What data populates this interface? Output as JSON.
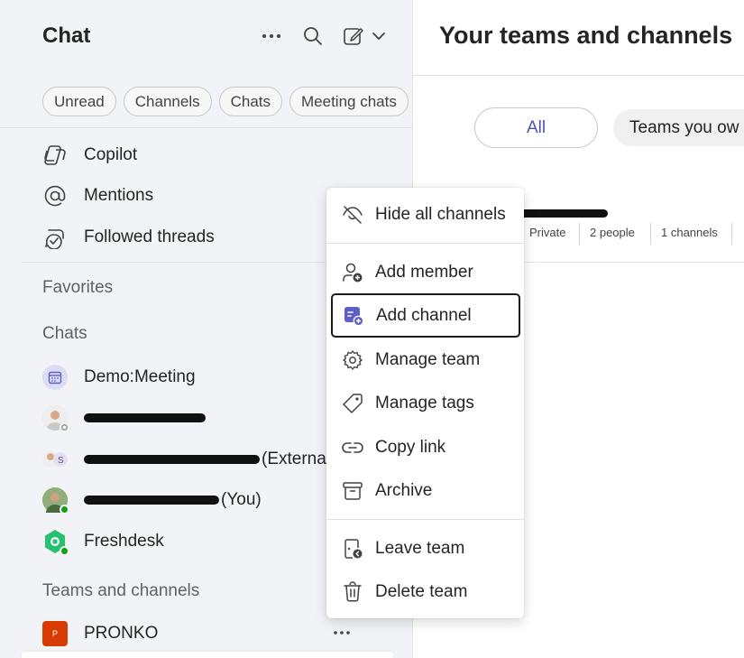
{
  "left": {
    "title": "Chat",
    "header_icons": [
      "more-icon",
      "search-icon",
      "compose-icon",
      "chevron-down-icon"
    ],
    "filters": [
      "Unread",
      "Channels",
      "Chats",
      "Meeting chats"
    ],
    "nav": [
      {
        "label": "Copilot",
        "icon": "copilot-icon"
      },
      {
        "label": "Mentions",
        "icon": "at-icon"
      },
      {
        "label": "Followed threads",
        "icon": "followed-threads-icon"
      }
    ],
    "favorites_label": "Favorites",
    "chats_label": "Chats",
    "chats": [
      {
        "label": "Demo:Meeting",
        "type": "meeting"
      },
      {
        "label": "",
        "type": "person-redacted",
        "presence": "offline"
      },
      {
        "label": "(Externa",
        "type": "person-redacted-external"
      },
      {
        "label": "(You)",
        "type": "person-redacted-you",
        "presence": "available"
      },
      {
        "label": "Freshdesk",
        "type": "app",
        "presence": "available"
      }
    ],
    "teams_label": "Teams and channels",
    "teams": [
      {
        "label": "PRONKO",
        "tile_letter": "P",
        "tile_color": "#d83b01"
      }
    ]
  },
  "right": {
    "title": "Your teams and channels",
    "tabs": {
      "all": "All",
      "own": "Teams you ow"
    },
    "team_row": {
      "privacy": "Private",
      "people": "2 people",
      "channels": "1 channels"
    }
  },
  "menu": {
    "items": [
      {
        "label": "Hide all channels",
        "icon": "eye-off-icon"
      },
      {
        "label": "Add member",
        "icon": "person-add-icon"
      },
      {
        "label": "Add channel",
        "icon": "channel-add-icon"
      },
      {
        "label": "Manage team",
        "icon": "gear-icon"
      },
      {
        "label": "Manage tags",
        "icon": "tag-icon"
      },
      {
        "label": "Copy link",
        "icon": "link-icon"
      },
      {
        "label": "Archive",
        "icon": "archive-icon"
      },
      {
        "label": "Leave team",
        "icon": "leave-team-icon"
      },
      {
        "label": "Delete team",
        "icon": "trash-icon"
      }
    ]
  },
  "colors": {
    "accent": "#4f52b2",
    "available": "#13a10e",
    "team_tile": "#d83b01"
  }
}
